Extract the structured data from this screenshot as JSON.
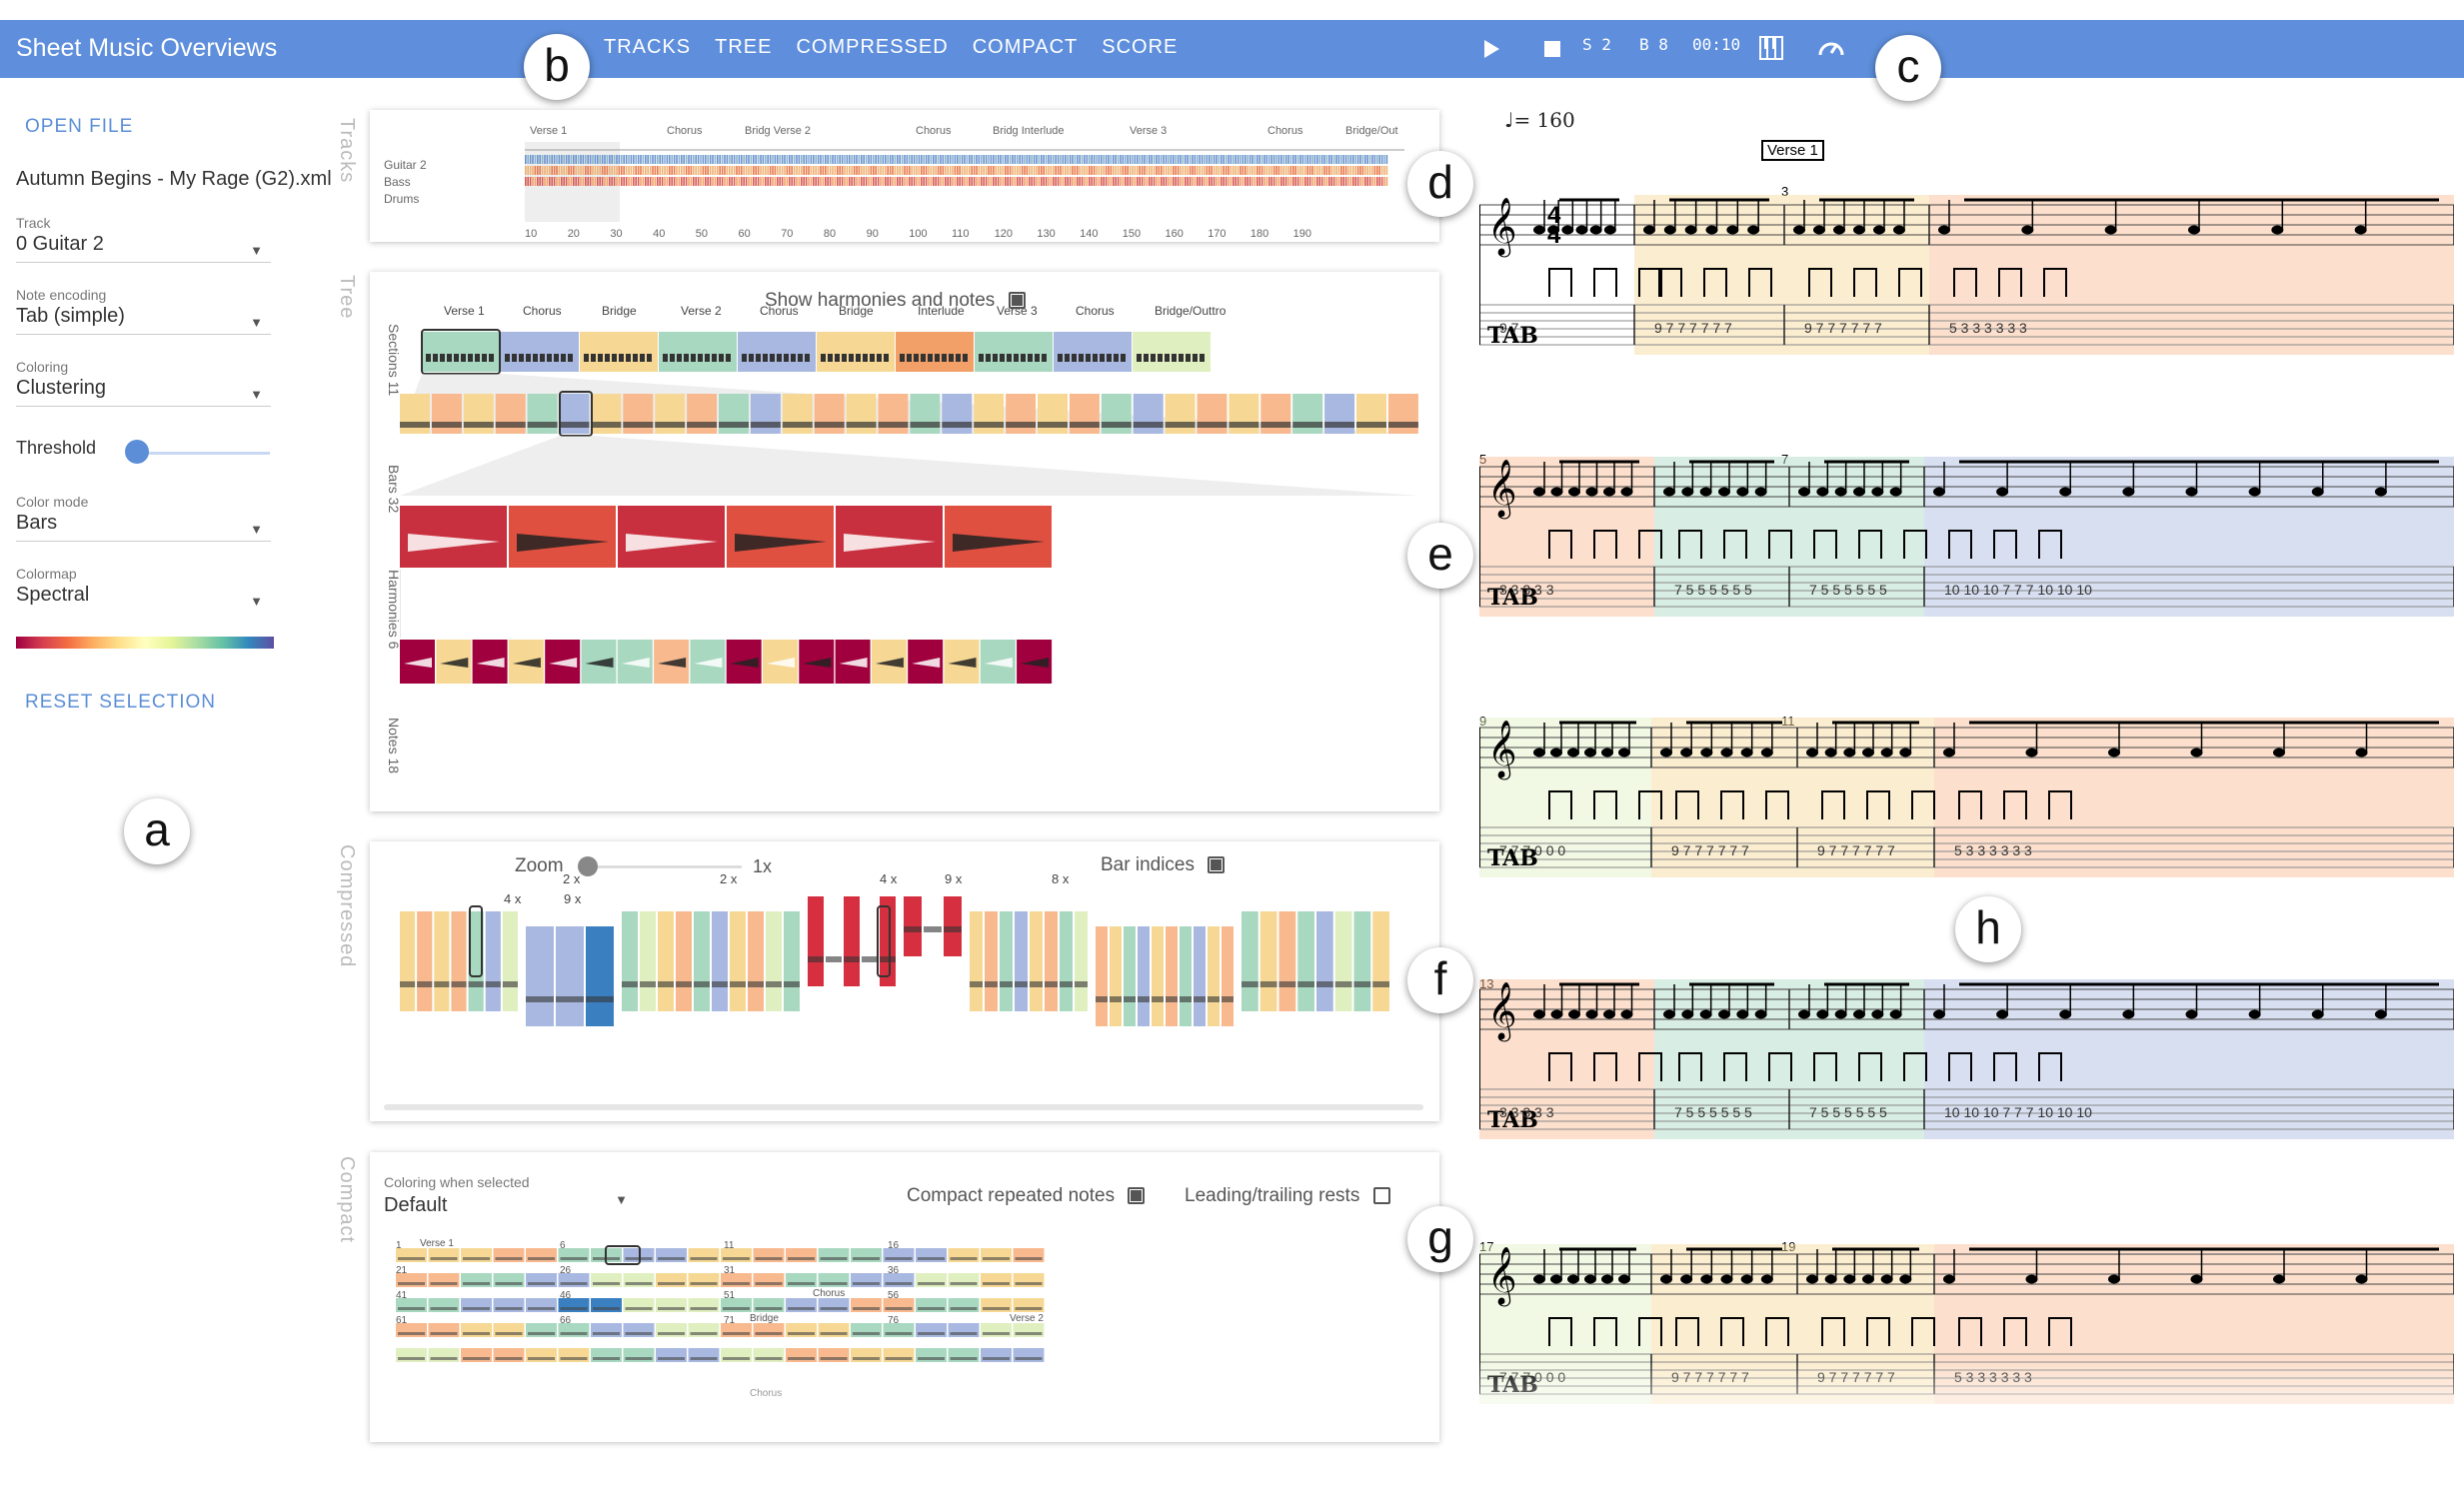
{
  "app": {
    "title": "Sheet Music Overviews"
  },
  "nav": [
    "TRACKS",
    "TREE",
    "COMPRESSED",
    "COMPACT",
    "SCORE"
  ],
  "transport": {
    "section": "S 2",
    "bar": "B 8",
    "time": "00:10"
  },
  "markers": {
    "a": "a",
    "b": "b",
    "c": "c",
    "d": "d",
    "e": "e",
    "f": "f",
    "g": "g",
    "h": "h"
  },
  "sidebar": {
    "open_file": "OPEN FILE",
    "file_name": "Autumn Begins - My Rage (G2).xml",
    "track": {
      "label": "Track",
      "value": "0 Guitar 2"
    },
    "note_encoding": {
      "label": "Note encoding",
      "value": "Tab (simple)"
    },
    "coloring": {
      "label": "Coloring",
      "value": "Clustering"
    },
    "threshold_label": "Threshold",
    "threshold": 0.0,
    "color_mode": {
      "label": "Color mode",
      "value": "Bars"
    },
    "colormap": {
      "label": "Colormap",
      "value": "Spectral"
    },
    "reset": "RESET SELECTION"
  },
  "view_labels": {
    "tracks": "Tracks",
    "tree": "Tree",
    "compressed": "Compressed",
    "compact": "Compact"
  },
  "tracks": {
    "sections": [
      "Verse 1",
      "Chorus",
      "Bridg Verse 2",
      "Chorus",
      "Bridg Interlude",
      "Verse 3",
      "Chorus",
      "Bridge/Out"
    ],
    "instruments": [
      "Guitar 2",
      "Bass",
      "Drums"
    ],
    "ticks": [
      "10",
      "20",
      "30",
      "40",
      "50",
      "60",
      "70",
      "80",
      "90",
      "100",
      "110",
      "120",
      "130",
      "140",
      "150",
      "160",
      "170",
      "180",
      "190"
    ]
  },
  "tree": {
    "show_label": "Show harmonies and notes",
    "show": true,
    "row_labels": [
      "Sections 11",
      "Bars 32",
      "Harmonies 6",
      "Notes 18"
    ],
    "sections": [
      "Verse 1",
      "Chorus",
      "Bridge",
      "Verse 2",
      "Chorus",
      "Bridge",
      "Interlude",
      "Verse 3",
      "Chorus",
      "Bridge/Outtro"
    ]
  },
  "compressed": {
    "zoom_label": "Zoom",
    "zoom_value": "1x",
    "bar_indices_label": "Bar indices",
    "bar_indices": true,
    "repeats": [
      "2 x",
      "4 x",
      "9 x",
      "2 x",
      "4 x",
      "9 x",
      "8 x"
    ]
  },
  "compact": {
    "coloring_label": "Coloring when selected",
    "coloring_value": "Default",
    "compact_repeated_label": "Compact repeated notes",
    "compact_repeated": true,
    "leading_trailing_label": "Leading/trailing rests",
    "leading_trailing": false,
    "row_starts": [
      "1",
      "6",
      "11",
      "16",
      "21",
      "26",
      "31",
      "36",
      "41",
      "46",
      "51",
      "56",
      "61",
      "66",
      "71",
      "76"
    ],
    "section_labels": [
      "Verse 1",
      "Chorus",
      "Bridge",
      "Verse 2",
      "Chorus"
    ]
  },
  "score": {
    "tempo": "= 160",
    "section_label": "Verse 1",
    "measure_numbers": [
      "3",
      "5",
      "7",
      "9",
      "11",
      "13",
      "17",
      "19"
    ],
    "tab_clef": "TAB",
    "time_sig": "4",
    "tab_rows": [
      [
        "9 7",
        "9 7  7 7 7 7 7",
        "9 7  7 7 7 7 7",
        "5 3  3 3 3 3 3"
      ],
      [
        "3 3 3 3 3",
        "7 5  5 5 5 5 5",
        "7 5  5 5 5 5 5",
        "10 10 10  7 7 7  10 10 10"
      ],
      [
        "7 7 7  0 0 0",
        "9 7  7 7 7 7 7",
        "9 7  7 7 7 7 7",
        "5 3  3 3 3 3 3"
      ],
      [
        "3 3 3 3 3",
        "7 5  5 5 5 5 5",
        "7 5  5 5 5 5 5",
        "10 10 10  7 7 7  10 10 10"
      ],
      [
        "7 7 7  0 0 0",
        "9 7  7 7 7 7 7",
        "9 7  7 7 7 7 7",
        "5 3  3 3 3 3 3"
      ]
    ]
  },
  "colors": {
    "accent": "#5f8fdc",
    "clusters": [
      "#f6d894",
      "#f8b98e",
      "#a8d8c0",
      "#a8b8e0",
      "#e0efc0",
      "#f2a068",
      "#d62f3f",
      "#a0003e",
      "#3a7fc0",
      "#66c2a5"
    ]
  }
}
